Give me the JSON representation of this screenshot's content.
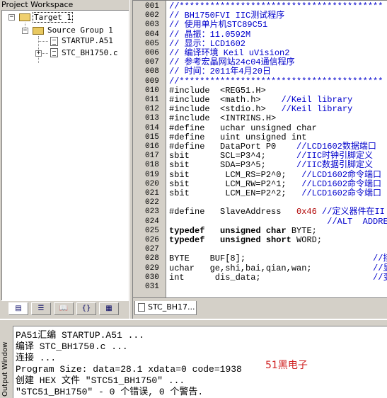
{
  "workspace": {
    "title": "Project Workspace",
    "tree": {
      "target": "Target 1",
      "group": "Source Group 1",
      "files": [
        "STARTUP.A51",
        "STC_BH1750.c"
      ]
    },
    "tab_glyphs": [
      "▤",
      "☰",
      "📖",
      "{}",
      "▦"
    ]
  },
  "editor": {
    "tab_label": "STC_BH17...",
    "lines": [
      {
        "n": "001",
        "t": "//****************************************",
        "c": "comment"
      },
      {
        "n": "002",
        "t": "// BH1750FVI IIC测试程序",
        "c": "comment"
      },
      {
        "n": "003",
        "t": "// 使用单片机STC89C51",
        "c": "comment"
      },
      {
        "n": "004",
        "t": "// 晶振：11.0592M",
        "c": "comment"
      },
      {
        "n": "005",
        "t": "// 显示：LCD1602",
        "c": "comment"
      },
      {
        "n": "006",
        "t": "// 编译环境 Keil uVision2",
        "c": "comment"
      },
      {
        "n": "007",
        "t": "// 参考宏晶网站24c04通信程序",
        "c": "comment"
      },
      {
        "n": "008",
        "t": "// 时间：2011年4月20日",
        "c": "comment"
      },
      {
        "n": "009",
        "t": "//****************************************",
        "c": "comment"
      },
      {
        "n": "010",
        "t": "#include  <REG51.H>",
        "c": "text"
      },
      {
        "n": "011",
        "t": "#include  <math.h>    //Keil library",
        "c": "mixed",
        "split": 21
      },
      {
        "n": "012",
        "t": "#include  <stdio.h>   //Keil library",
        "c": "mixed",
        "split": 21
      },
      {
        "n": "013",
        "t": "#include  <INTRINS.H>",
        "c": "text"
      },
      {
        "n": "014",
        "t": "#define   uchar unsigned char",
        "c": "text"
      },
      {
        "n": "015",
        "t": "#define   uint unsigned int",
        "c": "text"
      },
      {
        "n": "016",
        "t": "#define   DataPort P0    //LCD1602数据端口",
        "c": "mixed",
        "split": 24
      },
      {
        "n": "017",
        "t": "sbit      SCL=P3^4;      //IIC时钟引脚定义",
        "c": "mixed",
        "split": 24
      },
      {
        "n": "018",
        "t": "sbit      SDA=P3^5;      //IIC数据引脚定义",
        "c": "mixed",
        "split": 24
      },
      {
        "n": "019",
        "t": "sbit       LCM_RS=P2^0;   //LCD1602命令端口",
        "c": "mixed",
        "split": 25
      },
      {
        "n": "020",
        "t": "sbit       LCM_RW=P2^1;   //LCD1602命令端口",
        "c": "mixed",
        "split": 25
      },
      {
        "n": "021",
        "t": "sbit       LCM_EN=P2^2;   //LCD1602命令端口",
        "c": "mixed",
        "split": 25
      },
      {
        "n": "022",
        "t": "",
        "c": "text"
      },
      {
        "n": "023",
        "t": "#define   SlaveAddress   0x46 //定义器件在II",
        "c": "mixed",
        "split": 28
      },
      {
        "n": "024",
        "t": "                               //ALT  ADDRESS",
        "c": "comment"
      },
      {
        "n": "025",
        "t": "typedef   unsigned char BYTE;",
        "c": "kw"
      },
      {
        "n": "026",
        "t": "typedef   unsigned short WORD;",
        "c": "kw"
      },
      {
        "n": "027",
        "t": "",
        "c": "text"
      },
      {
        "n": "028",
        "t": "BYTE    BUF[8];                         //接",
        "c": "mixed",
        "split": 40
      },
      {
        "n": "029",
        "t": "uchar   ge,shi,bai,qian,wan;            //显",
        "c": "mixed",
        "split": 40
      },
      {
        "n": "030",
        "t": "int      dis_data;                      //变",
        "c": "mixed",
        "split": 40
      },
      {
        "n": "031",
        "t": "",
        "c": "text"
      }
    ]
  },
  "output": {
    "side_label": "Output Window",
    "lines": [
      "PA51汇编 STARTUP.A51 ...",
      "编译 STC_BH1750.c ...",
      "连接 ...",
      "Program Size: data=28.1 xdata=0 code=1938",
      "创建 HEX 文件 \"STC51_BH1750\" ...",
      "\"STC51_BH1750\" - 0 个错误, 0 个警告."
    ],
    "watermark": "51黑电子"
  }
}
